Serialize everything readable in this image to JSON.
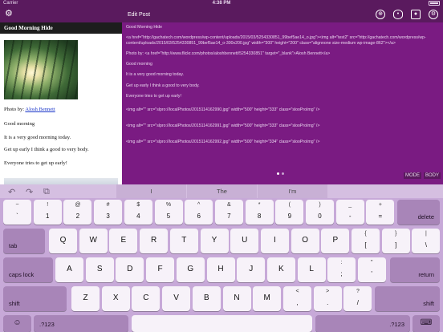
{
  "status": {
    "carrier": "Carrier",
    "time": "4:38 PM"
  },
  "preview": {
    "title": "Good Morning Hide",
    "photo_by_label": "Photo by:",
    "photo_by_link": "Alosh Bennett",
    "lines": [
      "Good morning",
      "It is a very good morning today.",
      "Get up early I think a good to very body.",
      "Everyone tries to get up early!"
    ]
  },
  "editor": {
    "header_title": "Edit Post",
    "icons": [
      "globe-icon",
      "eye-icon",
      "camera-icon",
      "settings-icon"
    ],
    "content": [
      "Good Morning Hide",
      "<a href=\"http://gachatech.com/wordpress/wp-content/uploads/2015/03/5254330851_99bef5ae14_o.jpg\"><img alt=\"test2\" src=\"http://gachatech.com/wordpress/wp-content/uploads/2015/03/5254330851_99bef5ae14_o-300x200.jpg\" width=\"300\" height=\"200\" class=\"alignnone size-medium wp-image-862\"></a>",
      "Photo by: <a href=\"http://www.flickr.com/photos/aloshbennett/5254330851\" target=\"_blank\">Alosh Bennett</a>",
      "Good morning",
      "It is a very good morning today.",
      "Get up early I think a good to very body.",
      "Everyone tries to get up early!",
      "<img alt=\"\" src=\"slpro://localPhotos/2015114162990.jpg\" width=\"500\" height=\"333\" class=\"slooProImg\" />",
      "<img alt=\"\" src=\"slpro://localPhotos/2015114162991.jpg\" width=\"500\" height=\"333\" class=\"slooProImg\" />",
      "<img alt=\"\" src=\"slpro://localPhotos/2015114162992.jpg\" width=\"500\" height=\"334\" class=\"slooProImg\" />"
    ],
    "mode_label": "MODE",
    "body_label": "BODY"
  },
  "keyboard": {
    "suggestions": [
      "I",
      "The",
      "I'm"
    ],
    "row1": [
      {
        "top": "~",
        "bot": "`"
      },
      {
        "top": "!",
        "bot": "1"
      },
      {
        "top": "@",
        "bot": "2"
      },
      {
        "top": "#",
        "bot": "3"
      },
      {
        "top": "$",
        "bot": "4"
      },
      {
        "top": "%",
        "bot": "5"
      },
      {
        "top": "^",
        "bot": "6"
      },
      {
        "top": "&",
        "bot": "7"
      },
      {
        "top": "*",
        "bot": "8"
      },
      {
        "top": "(",
        "bot": "9"
      },
      {
        "top": ")",
        "bot": "0"
      },
      {
        "top": "_",
        "bot": "-"
      },
      {
        "top": "+",
        "bot": "="
      }
    ],
    "delete": "delete",
    "tab": "tab",
    "row2": [
      "Q",
      "W",
      "E",
      "R",
      "T",
      "Y",
      "U",
      "I",
      "O",
      "P"
    ],
    "row2_extra": [
      {
        "top": "{",
        "bot": "["
      },
      {
        "top": "}",
        "bot": "]"
      },
      {
        "top": "|",
        "bot": "\\"
      }
    ],
    "caps": "caps lock",
    "row3": [
      "A",
      "S",
      "D",
      "F",
      "G",
      "H",
      "J",
      "K",
      "L"
    ],
    "row3_extra": [
      {
        "top": ":",
        "bot": ";"
      },
      {
        "top": "\"",
        "bot": "'"
      }
    ],
    "return": "return",
    "shift": "shift",
    "row4": [
      "Z",
      "X",
      "C",
      "V",
      "B",
      "N",
      "M"
    ],
    "row4_extra": [
      {
        "top": "<",
        "bot": ","
      },
      {
        "top": ">",
        "bot": "."
      },
      {
        "top": "?",
        "bot": "/"
      }
    ],
    "num": ".?123",
    "globe": "☺",
    "dismiss": "⌨"
  }
}
